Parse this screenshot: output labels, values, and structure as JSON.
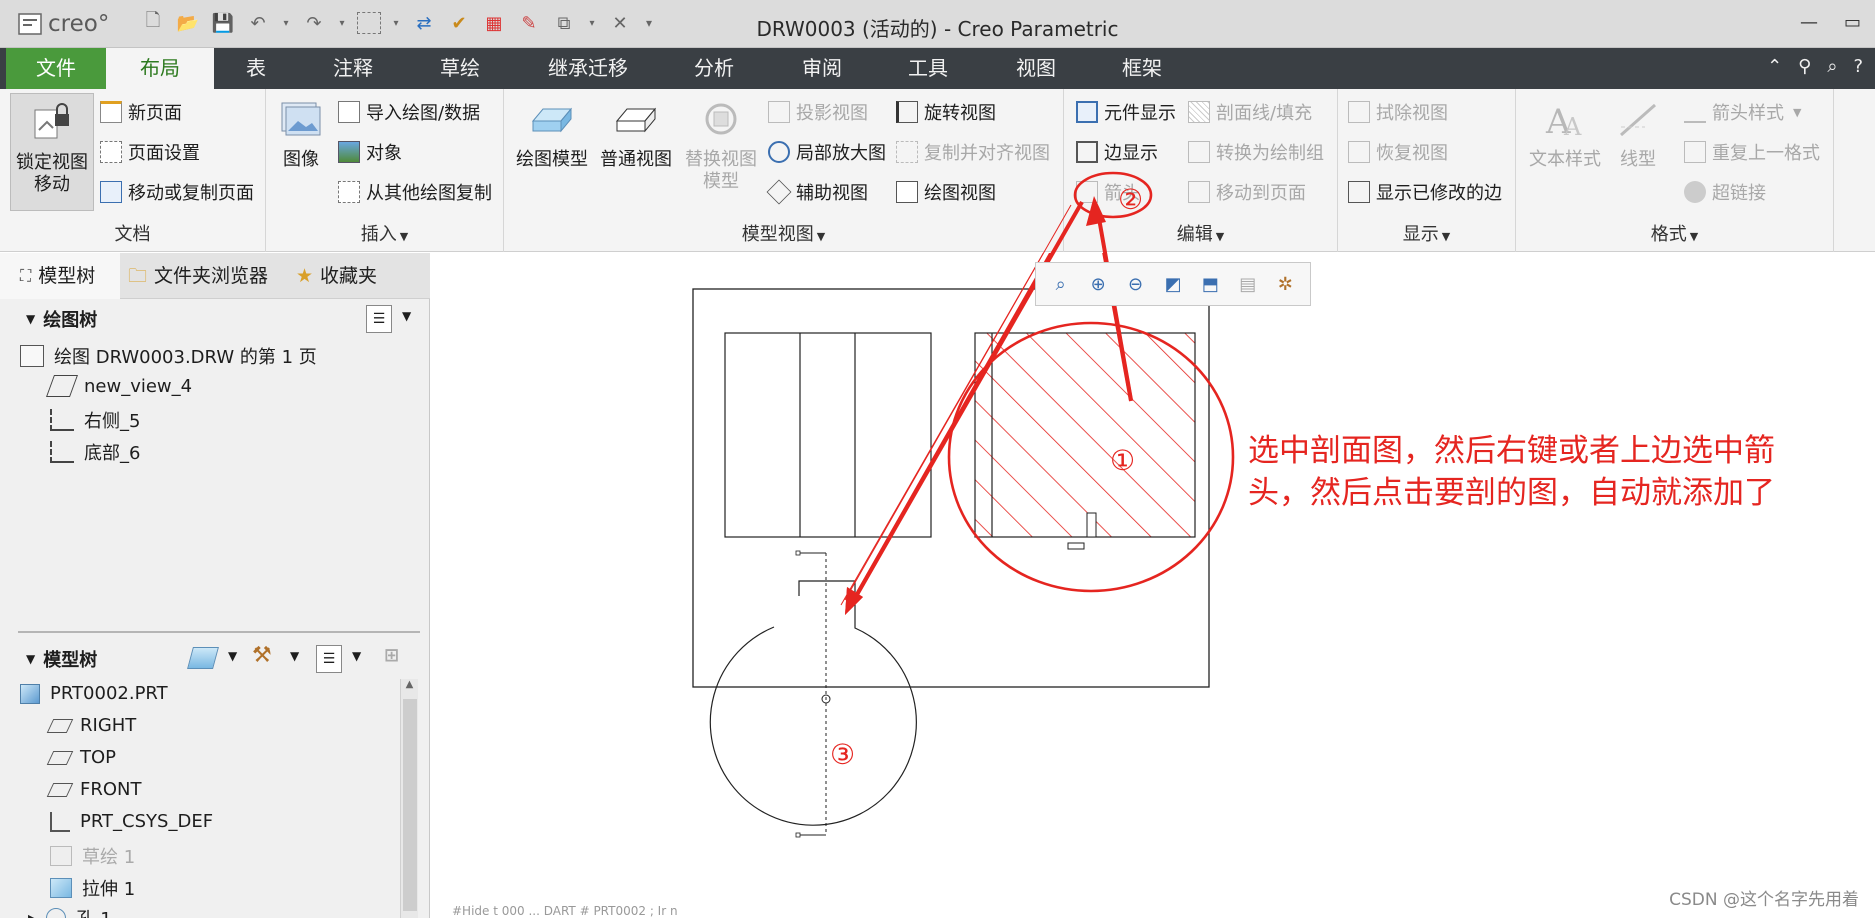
{
  "titlebar": {
    "logo": "creo°",
    "title": "DRW0003 (活动的) - Creo Parametric",
    "minimize": "—",
    "maximize": "▭"
  },
  "tabs": [
    "文件",
    "布局",
    "表",
    "注释",
    "草绘",
    "继承迁移",
    "分析",
    "审阅",
    "工具",
    "视图",
    "框架"
  ],
  "ribbon": {
    "document": {
      "label": "文档",
      "lock_view": "锁定视图\n移动",
      "new_page": "新页面",
      "page_setup": "页面设置",
      "move_copy_page": "移动或复制页面"
    },
    "insert": {
      "label": "插入",
      "image": "图像",
      "import_drawing": "导入绘图/数据",
      "object": "对象",
      "copy_from_other": "从其他绘图复制"
    },
    "model_views": {
      "label": "模型视图",
      "drawing_model": "绘图模型",
      "general_view": "普通视图",
      "replace_view_model": "替换视图\n模型",
      "projection_view": "投影视图",
      "detailed_view": "局部放大图",
      "auxiliary_view": "辅助视图",
      "revolved_view": "旋转视图",
      "copy_align_view": "复制并对齐视图",
      "drawing_view": "绘图视图"
    },
    "edit": {
      "label": "编辑",
      "component_display": "元件显示",
      "edge_display": "边显示",
      "arrow": "箭头",
      "section_fill": "剖面线/填充",
      "convert_group": "转换为绘制组",
      "move_to_page": "移动到页面"
    },
    "display": {
      "label": "显示",
      "erase_view": "拭除视图",
      "restore_view": "恢复视图",
      "show_modified_edges": "显示已修改的边"
    },
    "format": {
      "label": "格式",
      "text_style": "文本样式",
      "line_style": "线型",
      "arrow_style": "箭头样式",
      "repeat_format": "重复上一格式",
      "hyperlink": "超链接"
    }
  },
  "leftpanel": {
    "tabs": [
      "模型树",
      "文件夹浏览器",
      "收藏夹"
    ],
    "drawing_tree": {
      "title": "绘图树",
      "items": [
        "绘图 DRW0003.DRW 的第 1 页",
        "new_view_4",
        "右侧_5",
        "底部_6"
      ]
    },
    "model_tree": {
      "title": "模型树",
      "items": [
        "PRT0002.PRT",
        "RIGHT",
        "TOP",
        "FRONT",
        "PRT_CSYS_DEF",
        "草绘 1",
        "拉伸 1",
        "孔 1"
      ]
    }
  },
  "annotation": {
    "text_line1": "选中剖面图，然后右键或者上边选中箭",
    "text_line2": "头，然后点击要剖的图，自动就添加了",
    "num1": "①",
    "num2": "②",
    "num3": "③",
    "color": "#e52520"
  },
  "watermark": "CSDN @这个名字先用着",
  "statusbar": "#Hide t 000 ... DART # PRT0002 ; Ir n"
}
